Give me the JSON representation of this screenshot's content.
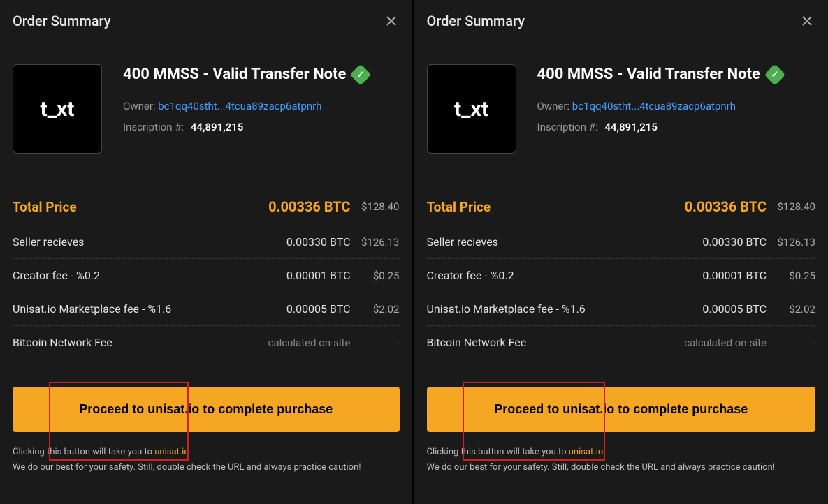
{
  "panels": [
    {
      "header": {
        "title": "Order Summary"
      },
      "item": {
        "thumb_text": "t_xt",
        "title": "400 MMSS - Valid Transfer Note",
        "owner_label": "Owner:",
        "owner_address": "bc1qq40stht...4tcua89zacp6atpnrh",
        "inscription_label": "Inscription #:",
        "inscription_number": "44,891,215"
      },
      "rows": [
        {
          "label": "Total Price",
          "btc": "0.00336 BTC",
          "usd": "$128.40",
          "highlight": true
        },
        {
          "label": "Seller recieves",
          "btc": "0.00330 BTC",
          "usd": "$126.13"
        },
        {
          "label": "Creator fee - %0.2",
          "btc": "0.00001 BTC",
          "usd": "$0.25"
        },
        {
          "label": "Unisat.io Marketplace fee - %1.6",
          "btc": "0.00005 BTC",
          "usd": "$2.02"
        },
        {
          "label": "Bitcoin Network Fee",
          "btc": "calculated on-site",
          "usd": "-",
          "calc": true
        }
      ],
      "proceed_label": "Proceed to unisat.io to complete purchase",
      "footer": {
        "line1_prefix": "Clicking this button will take you to ",
        "line1_link": "unisat.io",
        "line2": "We do our best for your safety. Still, double check the URL and always practice caution!"
      }
    },
    {
      "header": {
        "title": "Order Summary"
      },
      "item": {
        "thumb_text": "t_xt",
        "title": "400 MMSS - Valid Transfer Note",
        "owner_label": "Owner:",
        "owner_address": "bc1qq40stht...4tcua89zacp6atpnrh",
        "inscription_label": "Inscription #:",
        "inscription_number": "44,891,215"
      },
      "rows": [
        {
          "label": "Total Price",
          "btc": "0.00336 BTC",
          "usd": "$128.40",
          "highlight": true
        },
        {
          "label": "Seller recieves",
          "btc": "0.00330 BTC",
          "usd": "$126.13"
        },
        {
          "label": "Creator fee - %0.2",
          "btc": "0.00001 BTC",
          "usd": "$0.25"
        },
        {
          "label": "Unisat.io Marketplace fee - %1.6",
          "btc": "0.00005 BTC",
          "usd": "$2.02"
        },
        {
          "label": "Bitcoin Network Fee",
          "btc": "calculated on-site",
          "usd": "-",
          "calc": true
        }
      ],
      "proceed_label": "Proceed to unisat.io to complete purchase",
      "footer": {
        "line1_prefix": "Clicking this button will take you to ",
        "line1_link": "unisat.io",
        "line2": "We do our best for your safety. Still, double check the URL and always practice caution!"
      }
    }
  ]
}
